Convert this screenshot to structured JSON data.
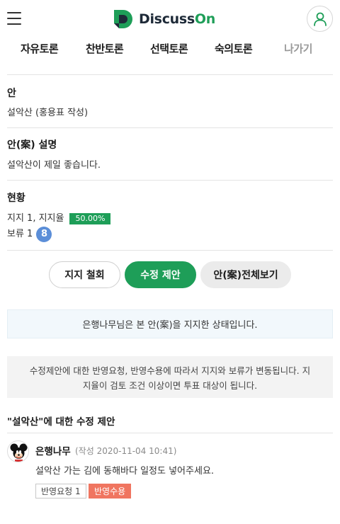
{
  "header": {
    "logo_text_main": "Discuss",
    "logo_text_accent": "On"
  },
  "tabs": [
    {
      "label": "자유토론"
    },
    {
      "label": "찬반토론"
    },
    {
      "label": "선택토론"
    },
    {
      "label": "숙의토론"
    },
    {
      "label": "나가기"
    }
  ],
  "proposal": {
    "title_label": "안",
    "title_value": "설악산 (홍용표 작성)",
    "desc_label": "안(案) 설명",
    "desc_value": "설악산이 제일 좋습니다."
  },
  "status": {
    "label": "현황",
    "support_text": "지지 1,  지지율",
    "support_rate": "50.00%",
    "hold_text": "보류 1",
    "hold_badge": "8"
  },
  "actions": {
    "withdraw_label": "지지 철회",
    "suggest_label": "수정 제안",
    "view_all_label": "안(案)전체보기"
  },
  "info_message": "은행나무님은 본 안(案)을 지지한 상태입니다.",
  "notice_message_line1": "수정제안에 대한 반영요청, 반영수용에 따라서 지지와 보류가 변동됩니다. 지",
  "notice_message_line2": "지율이 검토 조건 이상이면 투표 대상이 됩니다.",
  "suggestions": {
    "heading": "\"설악산\"에 대한 수정 제안",
    "items": [
      {
        "author": "은행나무",
        "meta": "(작성 2020-11-04 10:41)",
        "body": "설악산 가는 김에 동해바다 일정도 넣어주세요.",
        "request_tag": "반영요청 1",
        "accept_tag": "반영수용"
      }
    ]
  },
  "colors": {
    "brand_green": "#1e9e58",
    "hold_blue": "#5b8ed8",
    "accept_red": "#f07560"
  },
  "icons": {
    "menu": "hamburger-menu-icon",
    "profile": "user-profile-icon",
    "logo": "discusson-logo-icon",
    "comment_avatar": "mickey-avatar-icon"
  }
}
